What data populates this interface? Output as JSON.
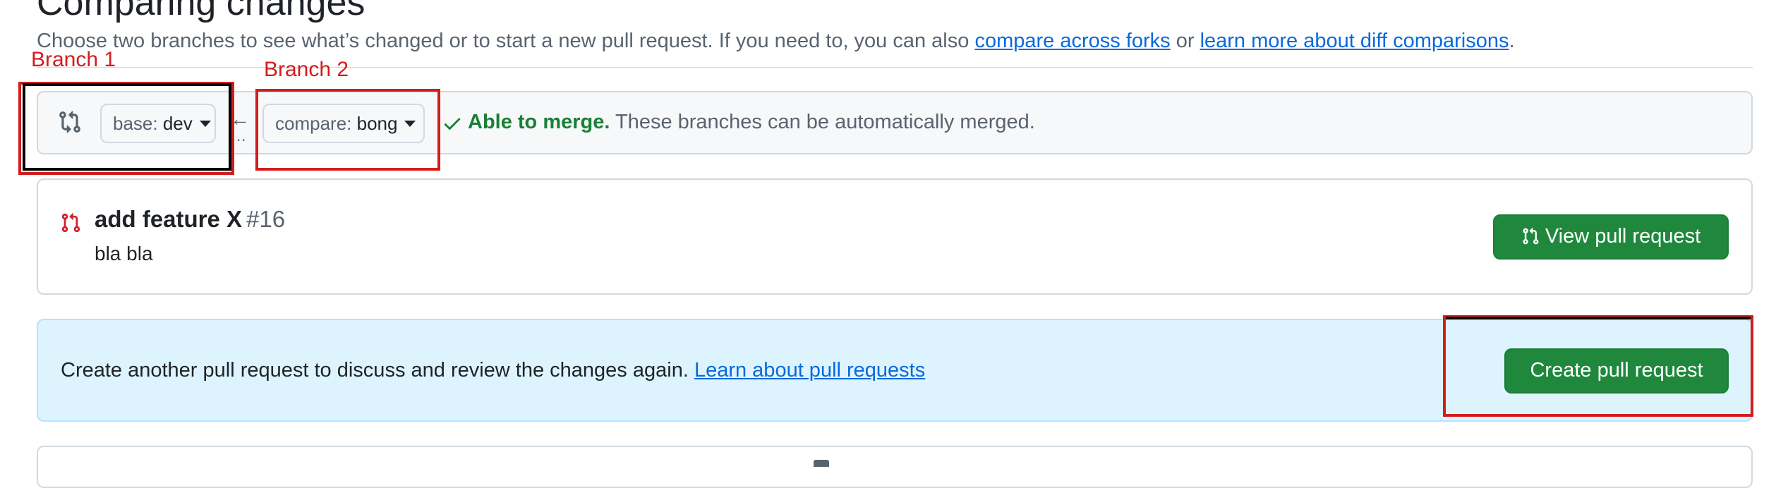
{
  "header": {
    "title": "Comparing changes",
    "desc_prefix": "Choose two branches to see what’s changed or to start a new pull request. If you need to, you can also ",
    "link_forks": "compare across forks",
    "desc_or": " or ",
    "link_diff": "learn more about diff comparisons",
    "desc_suffix": "."
  },
  "compare": {
    "base_prefix": "base: ",
    "base_branch": "dev",
    "compare_prefix": "compare: ",
    "compare_branch": "bong",
    "arrow": "←",
    "dots": "...",
    "merge_ok": "Able to merge.",
    "merge_text": " These branches can be automatically merged."
  },
  "annotations": {
    "branch1": "Branch 1",
    "branch2": "Branch 2"
  },
  "pull_request": {
    "title": "add feature X",
    "number": "#16",
    "body": "bla bla",
    "view_button": "View pull request"
  },
  "create": {
    "text": "Create another pull request to discuss and review the changes again. ",
    "link": "Learn about pull requests",
    "button": "Create pull request"
  },
  "colors": {
    "accent_green": "#1f883d",
    "link_blue": "#0969da",
    "annotation_red": "#d21d1d",
    "info_bg": "#ddf4ff"
  },
  "icons": [
    "git-compare-icon",
    "arrow-left-icon",
    "check-icon",
    "git-pull-request-icon",
    "caret-down-icon"
  ]
}
